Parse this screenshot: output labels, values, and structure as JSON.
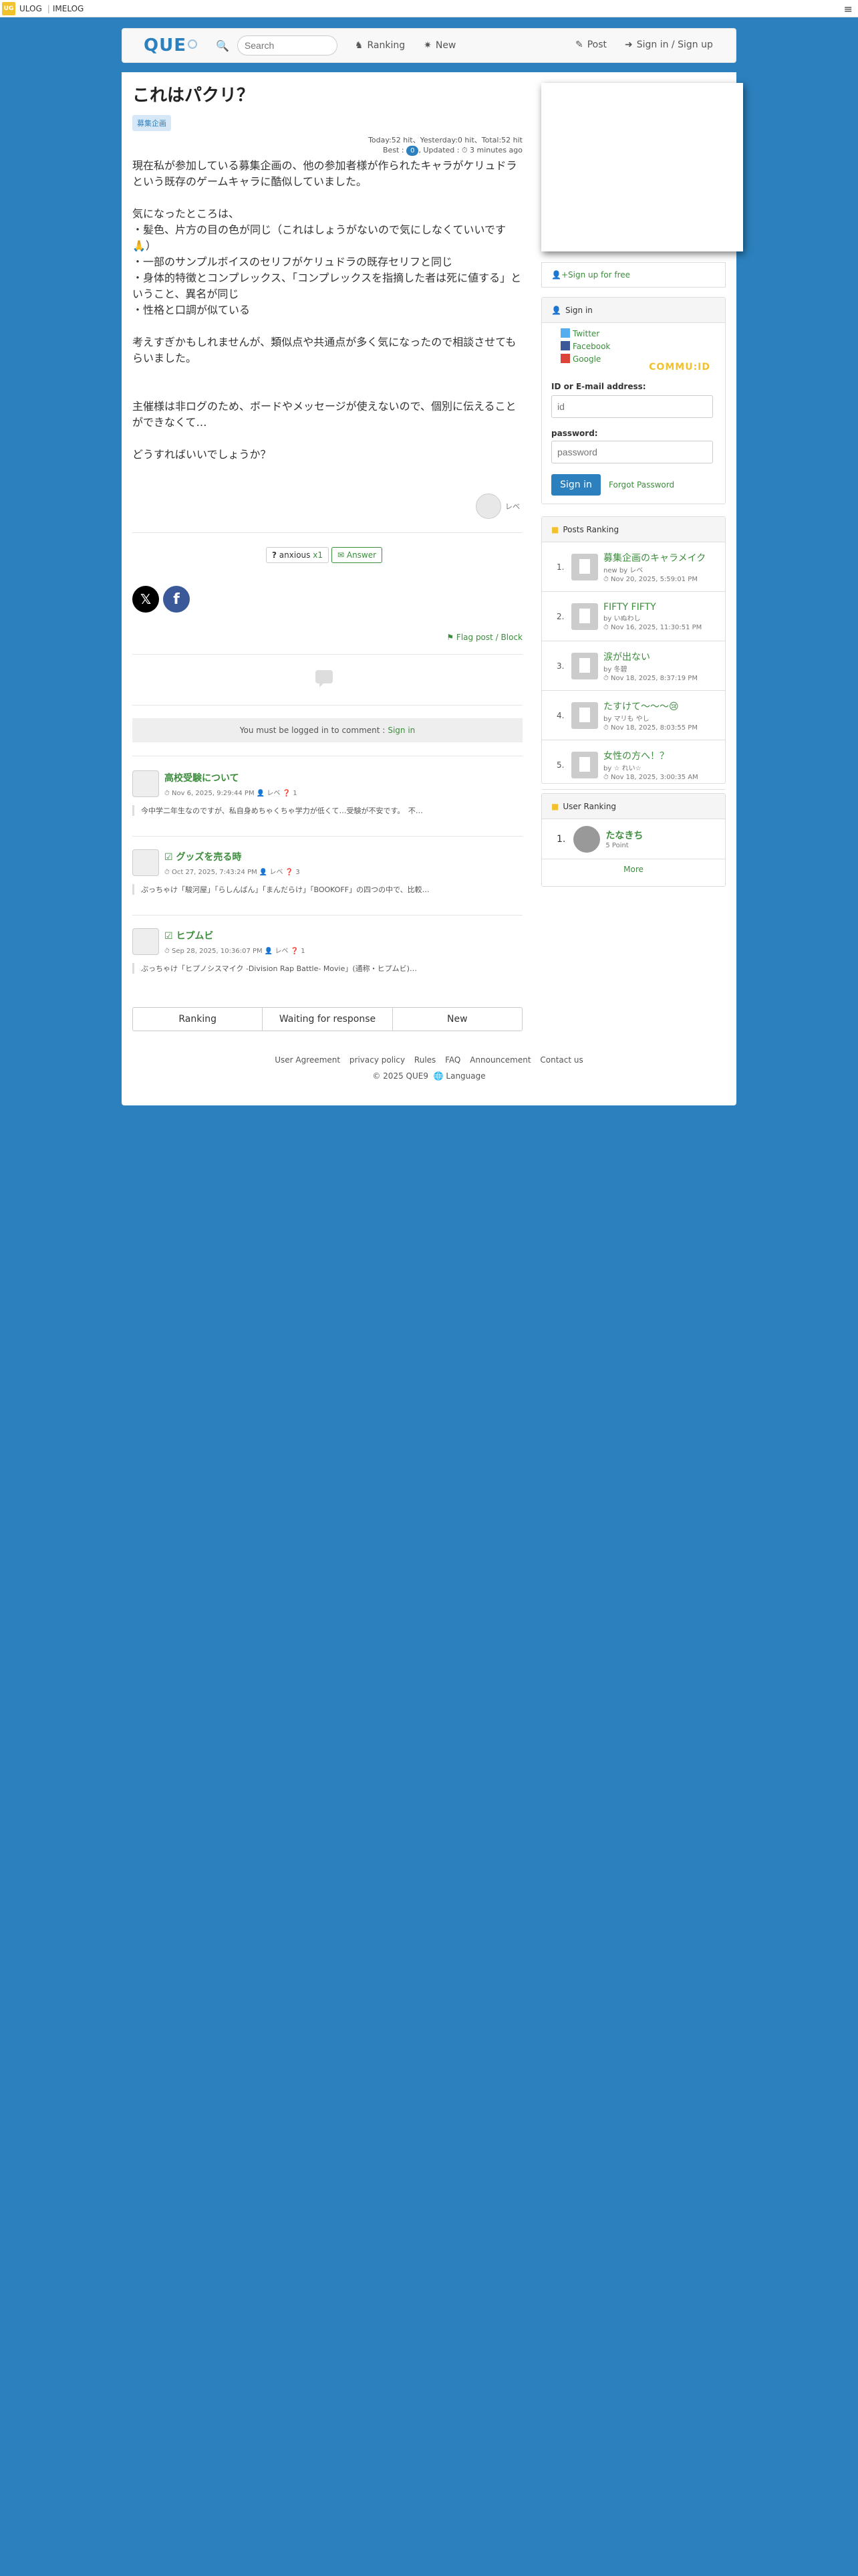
{
  "topbar": {
    "logo": "UG",
    "link1": "ULOG",
    "link2": "IMELOG",
    "menu": "≡"
  },
  "nav": {
    "logo": "QUE",
    "search_placeholder": "Search",
    "ranking": "Ranking",
    "new": "New",
    "post": "Post",
    "signin": "Sign in / Sign up"
  },
  "post": {
    "title": "これはパクリ？",
    "tag": "募集企画",
    "stats_line1": "Today:52 hit、Yesterday:0 hit、Total:52 hit",
    "stats_best": "Best :",
    "stats_best_badge": "0",
    "stats_updated": ", Updated : ⏱ 3 minutes ago",
    "body": "現在私が参加している募集企画の、他の参加者様が作られたキャラがケリュドラという既存のゲームキャラに酷似していました。\n\n気になったところは、\n・髪色、片方の目の色が同じ（これはしょうがないので気にしなくていいです🙏）\n・一部のサンプルボイスのセリフがケリュドラの既存セリフと同じ\n・身体的特徴とコンプレックス、「コンプレックスを指摘した者は死に値する」ということ、異名が同じ\n・性格と口調が似ている\n\n考えすぎかもしれませんが、類似点や共通点が多く気になったので相談させてもらいました。\n\n\n主催様は非ログのため、ボードやメッセージが使えないので、個別に伝えることができなくて…\n\nどうすればいいでしょうか？",
    "author": "レベ",
    "reaction_label": "anxious",
    "reaction_count": "x1",
    "answer_label": "Answer",
    "flag": "Flag post / Block",
    "login_prefix": "You must be logged in to comment :",
    "login_link": "Sign in"
  },
  "related": [
    {
      "title": "高校受験について",
      "meta": "⏱ Nov 6, 2025, 9:29:44 PM  👤 レベ  ❓ 1",
      "body": "今中学二年生なのですが、私自身めちゃくちゃ学力が低くて…受験が不安です。　不…"
    },
    {
      "title": "グッズを売る時",
      "meta": "⏱ Oct 27, 2025, 7:43:24 PM  👤 レベ  ❓ 3",
      "body": "ぷっちゃけ「駿河屋」「らしんばん」「まんだらけ」「BOOKOFF」の四つの中で、比較…"
    },
    {
      "title": "ヒプムビ",
      "meta": "⏱ Sep 28, 2025, 10:36:07 PM  👤 レベ  ❓ 1",
      "body": "ぶっちゃけ「ヒプノシスマイク -Division Rap Battle- Movie」(通称・ヒプムビ)…"
    }
  ],
  "tabs": [
    "Ranking",
    "Waiting for response",
    "New"
  ],
  "footer": {
    "links": [
      "User Agreement",
      "privacy policy",
      "Rules",
      "FAQ",
      "Announcement",
      "Contact us"
    ],
    "copy": "© 2025  QUE9",
    "language": "Language"
  },
  "sidebar": {
    "signup": "Sign up for free",
    "signin_title": "Sign in",
    "twitter": "Twitter",
    "facebook": "Facebook",
    "google": "Google",
    "commu": "COMMU:ID",
    "id_label": "ID or E-mail address:",
    "id_placeholder": "id",
    "pw_label": "password:",
    "pw_placeholder": "password",
    "signin_btn": "Sign in",
    "forgot": "Forgot Password",
    "posts_ranking_title": "Posts Ranking",
    "posts_ranking": [
      {
        "num": "1.",
        "title": "募集企画のキャラメイク",
        "by": "new by レベ",
        "date": "⏱ Nov 20, 2025, 5:59:01 PM"
      },
      {
        "num": "2.",
        "title": "FIFTY FIFTY",
        "by": "by いぬわし",
        "date": "⏱ Nov 16, 2025, 11:30:51 PM"
      },
      {
        "num": "3.",
        "title": "涙が出ない",
        "by": "by 冬碧",
        "date": "⏱ Nov 18, 2025, 8:37:19 PM"
      },
      {
        "num": "4.",
        "title": "たすけて〜〜〜😢",
        "by": "by マリも やし",
        "date": "⏱ Nov 18, 2025, 8:03:55 PM"
      },
      {
        "num": "5.",
        "title": "女性の方へ！？",
        "by": "by ☆ れい☆",
        "date": "⏱ Nov 18, 2025, 3:00:35 AM"
      }
    ],
    "more": "More",
    "user_ranking_title": "User Ranking",
    "user_ranking": [
      {
        "num": "1.",
        "name": "たなきち",
        "points": "5 Point"
      }
    ]
  }
}
